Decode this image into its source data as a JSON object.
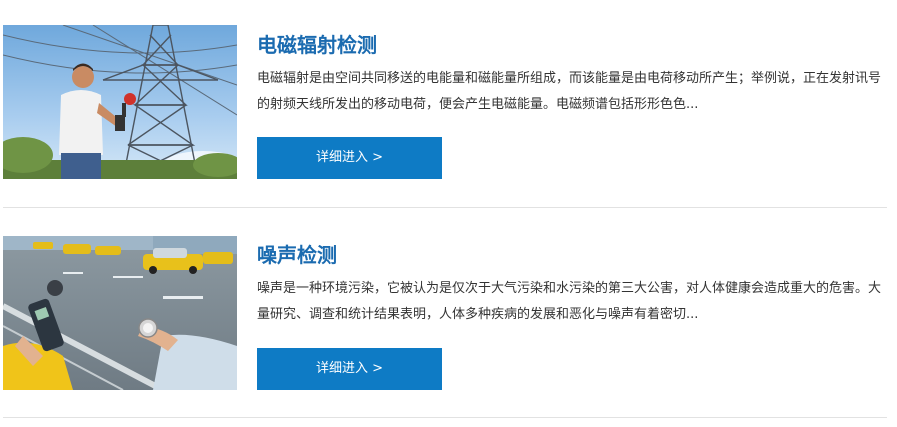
{
  "items": [
    {
      "title": "电磁辐射检测",
      "description": "电磁辐射是由空间共同移送的电能量和磁能量所组成，而该能量是由电荷移动所产生；举例说，正在发射讯号的射频天线所发出的移动电荷，便会产生电磁能量。电磁频谱包括形形色色...",
      "button_label": "详细进入 >"
    },
    {
      "title": "噪声检测",
      "description": "噪声是一种环境污染，它被认为是仅次于大气污染和水污染的第三大公害，对人体健康会造成重大的危害。大量研究、调查和统计结果表明，人体多种疾病的发展和恶化与噪声有着密切...",
      "button_label": "详细进入 >"
    }
  ],
  "colors": {
    "title": "#1b6bb0",
    "button_bg": "#0e7bc5",
    "button_text": "#ffffff",
    "body_text": "#333333",
    "divider": "#e2e2e2"
  }
}
